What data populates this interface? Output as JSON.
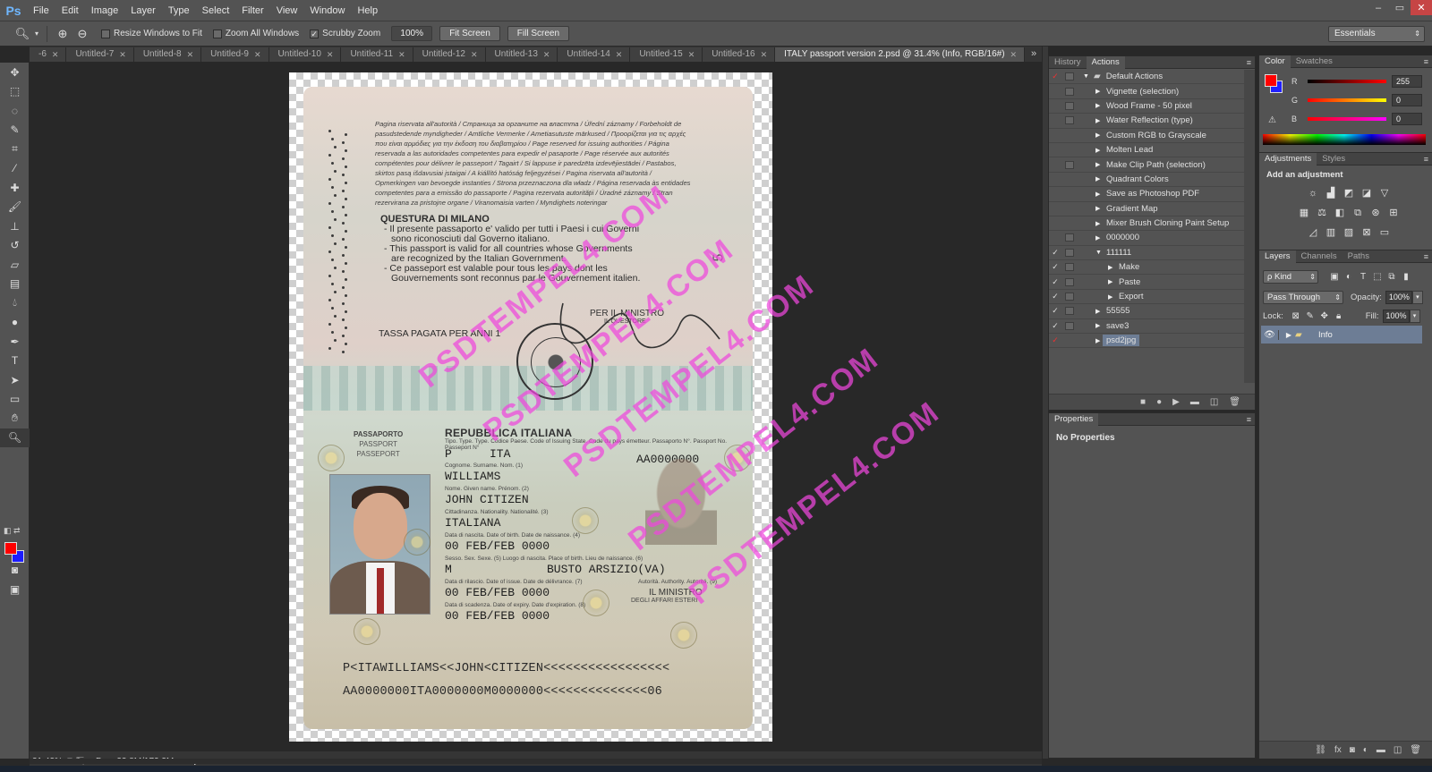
{
  "app": {
    "logo": "Ps",
    "menu": [
      "File",
      "Edit",
      "Image",
      "Layer",
      "Type",
      "Select",
      "Filter",
      "View",
      "Window",
      "Help"
    ],
    "window_controls": [
      "–",
      "▭",
      "✕"
    ]
  },
  "options_bar": {
    "resize_windows": "Resize Windows to Fit",
    "zoom_all": "Zoom All Windows",
    "scrubby_zoom": "Scrubby Zoom",
    "zoom_value": "100%",
    "fit_screen": "Fit Screen",
    "fill_screen": "Fill Screen",
    "workspace": "Essentials"
  },
  "tabs": [
    {
      "label": "-6"
    },
    {
      "label": "Untitled-7"
    },
    {
      "label": "Untitled-8"
    },
    {
      "label": "Untitled-9"
    },
    {
      "label": "Untitled-10"
    },
    {
      "label": "Untitled-11"
    },
    {
      "label": "Untitled-12"
    },
    {
      "label": "Untitled-13"
    },
    {
      "label": "Untitled-14"
    },
    {
      "label": "Untitled-15"
    },
    {
      "label": "Untitled-16"
    },
    {
      "label": "ITALY passport version 2.psd @ 31.4% (Info, RGB/16#)"
    }
  ],
  "passport": {
    "fine_print": "Pagina riservata all'autorità / Страница за органите на властта / Úřední záznamy / Forbeholdt de pasudstedende myndigheder / Amtliche Vermerke / Ametiasutuste märkused / Προορίζεται για τις αρχές που είναι αρμόδιες για την έκδοση του διαβατηρίου / Page reserved for issuing authorities / Página reservada a las autoridades competentes para expedir el pasaporte / Page réservée aux autorités compétentes pour délivrer le passeport / Tagairt / Si lappuse ir paredzēta izdevējiestādei / Pastabos, skirtos pasą išdavusiai įstaigai / A kiállító hatóság feljegyzései / Pagina riservata all'autorità / Opmerkingen van bevoegde instanties / Strona przeznaczona dla władz / Página reservada às entidades competentes para a emissão do passaporte / Pagina rezervata autorității / Úradné záznamy / Stran rezervirana za pristojne organe / Viranomaisia varten / Myndighets noteringar",
    "questura": "QUESTURA DI MILANO",
    "validity": [
      "- Il presente passaporto e' valido per tutti i Paesi i cui Governi",
      "  sono riconosciuti dal Governo italiano.",
      "- This passport is valid for all countries whose Governments",
      "  are recognized by the Italian Government.",
      "- Ce passeport est valable pour tous les pays dont les",
      "  Gouvernements sont reconnus par le Gouvernement italien."
    ],
    "tassa": "TASSA PAGATA PER ANNI 1",
    "per_il_ministro": "PER IL MINISTRO",
    "il_questore": "IL QUESTORE",
    "page_number": "5",
    "passaporto": "PASSAPORTO",
    "passport_en": "PASSPORT",
    "passeport_fr": "PASSEPORT",
    "repubblica": "REPUBBLICA ITALIANA",
    "type_label": "Tipo. Type. Type. Codice Paese. Code of Issuing State. Code du pays émetteur. Passaporto N°. Passport No. Passeport N°",
    "type_value": "P",
    "country_value": "ITA",
    "passport_no": "AA0000000",
    "surname_label": "Cognome. Surname. Nom. (1)",
    "surname": "WILLIAMS",
    "given_label": "Nome. Given name. Prénom. (2)",
    "given": "JOHN CITIZEN",
    "nationality_label": "Cittadinanza. Nationality. Nationalité. (3)",
    "nationality": "ITALIANA",
    "dob_label": "Data di nascita. Date of birth. Date de naissance. (4)",
    "dob": "00 FEB/FEB 0000",
    "sex_label": "Sesso. Sex. Sexe. (5)   Luogo di nascita. Place of birth. Lieu de naissance. (6)",
    "sex": "M",
    "pob": "BUSTO ARSIZIO(VA)",
    "issue_label": "Data di rilascio. Date of issue. Date de délivrance. (7)",
    "issue": "00 FEB/FEB 0000",
    "authority_label": "Autorità. Authority. Autorité. (9)",
    "authority": "IL MINISTRO",
    "authority_sub": "DEGLI AFFARI ESTERI",
    "expiry_label": "Data di scadenza. Date of expiry. Date d'expiration. (8)",
    "expiry": "00 FEB/FEB 0000",
    "mrz1": "P<ITAWILLIAMS<<JOHN<CITIZEN<<<<<<<<<<<<<<<<<",
    "mrz2": "AA0000000ITA0000000M0000000<<<<<<<<<<<<<<06"
  },
  "watermark": "PSDTEMPEL4.COM",
  "status": {
    "zoom": "31.43%",
    "doc": "Doc: 33.8M/172.3M"
  },
  "history_panel": {
    "tabs": [
      "History",
      "Actions"
    ],
    "actions": [
      {
        "check": "✓",
        "red": true,
        "dlg": true,
        "tri": "▼",
        "indent": 0,
        "label": "Default Actions",
        "folder": true
      },
      {
        "check": "",
        "red": false,
        "dlg": true,
        "tri": "▶",
        "indent": 1,
        "label": "Vignette (selection)"
      },
      {
        "check": "",
        "red": false,
        "dlg": true,
        "tri": "▶",
        "indent": 1,
        "label": "Wood Frame - 50 pixel"
      },
      {
        "check": "",
        "red": false,
        "dlg": true,
        "tri": "▶",
        "indent": 1,
        "label": "Water Reflection (type)"
      },
      {
        "check": "",
        "red": false,
        "dlg": false,
        "tri": "▶",
        "indent": 1,
        "label": "Custom RGB to Grayscale"
      },
      {
        "check": "",
        "red": false,
        "dlg": false,
        "tri": "▶",
        "indent": 1,
        "label": "Molten Lead"
      },
      {
        "check": "",
        "red": false,
        "dlg": true,
        "tri": "▶",
        "indent": 1,
        "label": "Make Clip Path (selection)"
      },
      {
        "check": "",
        "red": false,
        "dlg": false,
        "tri": "▶",
        "indent": 1,
        "label": "Quadrant Colors"
      },
      {
        "check": "",
        "red": false,
        "dlg": false,
        "tri": "▶",
        "indent": 1,
        "label": "Save as Photoshop PDF"
      },
      {
        "check": "",
        "red": false,
        "dlg": false,
        "tri": "▶",
        "indent": 1,
        "label": "Gradient Map"
      },
      {
        "check": "",
        "red": false,
        "dlg": false,
        "tri": "▶",
        "indent": 1,
        "label": "Mixer Brush Cloning Paint Setup"
      },
      {
        "check": "",
        "red": false,
        "dlg": true,
        "tri": "▶",
        "indent": 1,
        "label": "0000000"
      },
      {
        "check": "✓",
        "red": false,
        "dlg": true,
        "tri": "▼",
        "indent": 1,
        "label": "111111"
      },
      {
        "check": "✓",
        "red": false,
        "dlg": true,
        "tri": "▶",
        "indent": 2,
        "label": "Make"
      },
      {
        "check": "✓",
        "red": false,
        "dlg": true,
        "tri": "▶",
        "indent": 2,
        "label": "Paste"
      },
      {
        "check": "✓",
        "red": false,
        "dlg": true,
        "tri": "▶",
        "indent": 2,
        "label": "Export"
      },
      {
        "check": "✓",
        "red": false,
        "dlg": true,
        "tri": "▶",
        "indent": 1,
        "label": "55555"
      },
      {
        "check": "✓",
        "red": false,
        "dlg": true,
        "tri": "▶",
        "indent": 1,
        "label": "save3"
      },
      {
        "check": "✓",
        "red": true,
        "dlg": false,
        "tri": "▶",
        "indent": 1,
        "label": "psd2jpg",
        "selected": true
      }
    ]
  },
  "properties_panel": {
    "tab": "Properties",
    "empty": "No Properties"
  },
  "color_panel": {
    "tabs": [
      "Color",
      "Swatches"
    ],
    "r_label": "R",
    "r": "255",
    "g_label": "G",
    "g": "0",
    "b_label": "B",
    "b": "0",
    "fg": "#ff0000",
    "bg": "#2020ff"
  },
  "adjustments_panel": {
    "tabs": [
      "Adjustments",
      "Styles"
    ],
    "title": "Add an adjustment"
  },
  "layers_panel": {
    "tabs": [
      "Layers",
      "Channels",
      "Paths"
    ],
    "kind": "ρ Kind",
    "blend": "Pass Through",
    "opacity_label": "Opacity:",
    "opacity": "100%",
    "lock_label": "Lock:",
    "fill_label": "Fill:",
    "fill": "100%",
    "layer_name": "Info"
  }
}
